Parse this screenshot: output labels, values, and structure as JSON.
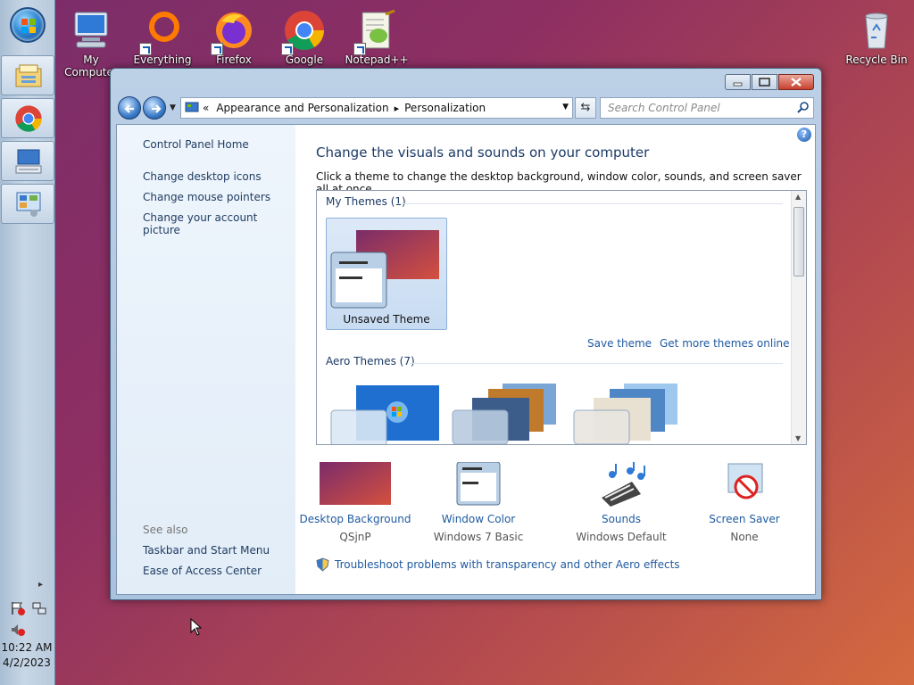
{
  "desktop": {
    "icons": [
      {
        "label": "My Computer",
        "icon": "computer-icon"
      },
      {
        "label": "Everything",
        "icon": "everything-icon"
      },
      {
        "label": "Firefox",
        "icon": "firefox-icon"
      },
      {
        "label": "Google",
        "icon": "chrome-icon"
      },
      {
        "label": "Notepad++",
        "icon": "notepadpp-icon"
      },
      {
        "label": "Recycle Bin",
        "icon": "recycle-bin-icon"
      }
    ]
  },
  "taskbar": {
    "pinned": [
      "explorer-icon",
      "chrome-icon",
      "keyboard-display-icon",
      "control-panel-icon"
    ],
    "clock": {
      "time": "10:22 AM",
      "date": "4/2/2023"
    }
  },
  "window": {
    "address": {
      "prefix": "«",
      "crumbs": [
        "Appearance and Personalization",
        "Personalization"
      ]
    },
    "search_placeholder": "Search Control Panel",
    "left_pane": {
      "home": "Control Panel Home",
      "links": [
        "Change desktop icons",
        "Change mouse pointers",
        "Change your account picture"
      ],
      "see_also_title": "See also",
      "see_also": [
        "Taskbar and Start Menu",
        "Ease of Access Center"
      ]
    },
    "main": {
      "heading": "Change the visuals and sounds on your computer",
      "subtext": "Click a theme to change the desktop background, window color, sounds, and screen saver all at once.",
      "my_themes": "My Themes (1)",
      "unsaved_theme": "Unsaved Theme",
      "save_theme": "Save theme",
      "get_more": "Get more themes online",
      "aero_themes": "Aero Themes (7)",
      "bottom": [
        {
          "label": "Desktop Background",
          "value": "QSjnP"
        },
        {
          "label": "Window Color",
          "value": "Windows 7 Basic"
        },
        {
          "label": "Sounds",
          "value": "Windows Default"
        },
        {
          "label": "Screen Saver",
          "value": "None"
        }
      ],
      "troubleshoot": "Troubleshoot problems with transparency and other Aero effects"
    }
  },
  "colors": {
    "link": "#1f5aa0",
    "heading": "#1b3a66",
    "theme_gradient_start": "#7b2c6a",
    "theme_gradient_end": "#d4503e"
  }
}
